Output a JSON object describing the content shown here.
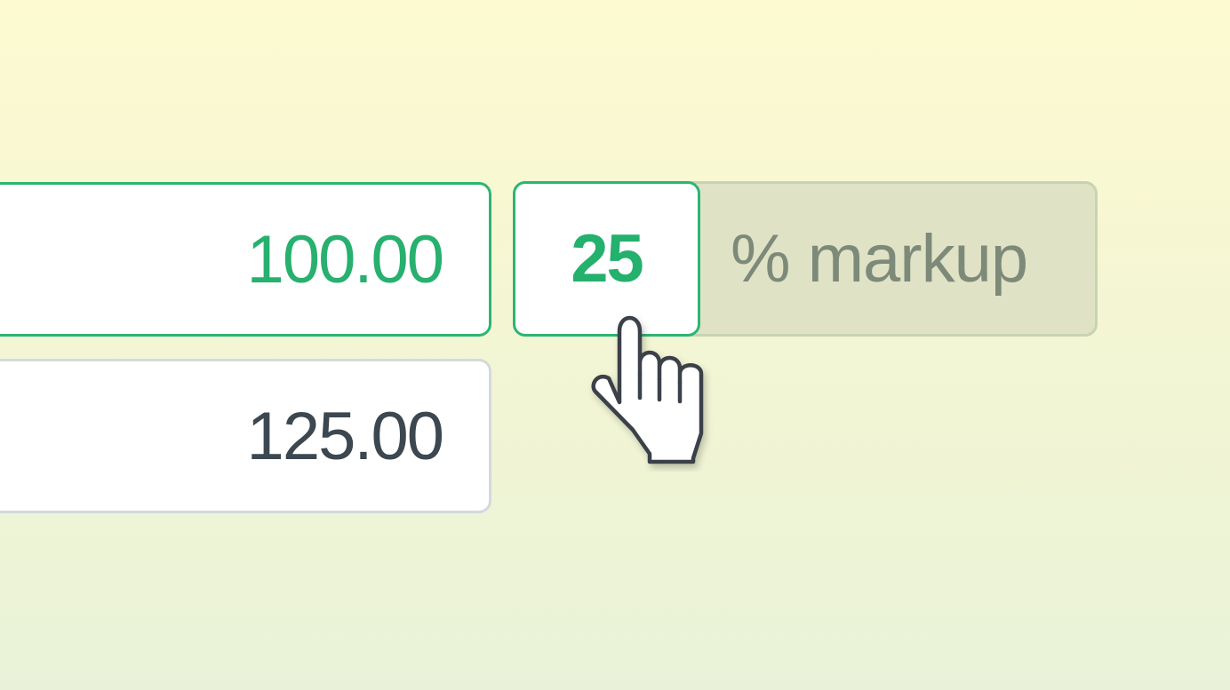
{
  "cost": {
    "value": "100.00"
  },
  "price": {
    "value": "125.00"
  },
  "markup": {
    "value": "25",
    "addon_label": "% markup"
  },
  "cursor": {
    "icon": "hand-pointer-icon"
  },
  "colors": {
    "accent_green": "#2bb673",
    "neutral_border": "#d3d9de",
    "text_dark": "#3c4750",
    "addon_background": "#e0e2c5",
    "addon_text": "#7d8a7a"
  }
}
